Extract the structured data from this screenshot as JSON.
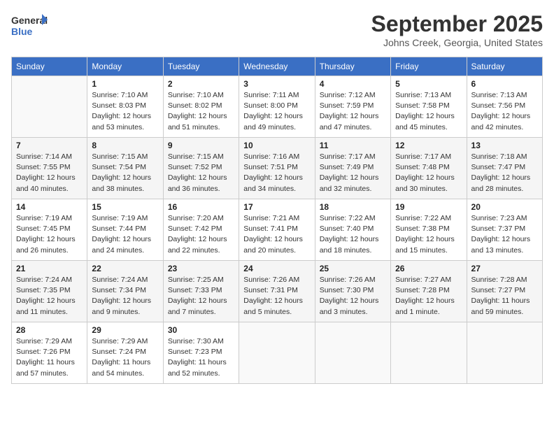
{
  "header": {
    "logo_text_general": "General",
    "logo_text_blue": "Blue",
    "month": "September 2025",
    "location": "Johns Creek, Georgia, United States"
  },
  "weekdays": [
    "Sunday",
    "Monday",
    "Tuesday",
    "Wednesday",
    "Thursday",
    "Friday",
    "Saturday"
  ],
  "weeks": [
    [
      {
        "day": "",
        "empty": true
      },
      {
        "day": "1",
        "sunrise": "7:10 AM",
        "sunset": "8:03 PM",
        "daylight": "12 hours and 53 minutes."
      },
      {
        "day": "2",
        "sunrise": "7:10 AM",
        "sunset": "8:02 PM",
        "daylight": "12 hours and 51 minutes."
      },
      {
        "day": "3",
        "sunrise": "7:11 AM",
        "sunset": "8:00 PM",
        "daylight": "12 hours and 49 minutes."
      },
      {
        "day": "4",
        "sunrise": "7:12 AM",
        "sunset": "7:59 PM",
        "daylight": "12 hours and 47 minutes."
      },
      {
        "day": "5",
        "sunrise": "7:13 AM",
        "sunset": "7:58 PM",
        "daylight": "12 hours and 45 minutes."
      },
      {
        "day": "6",
        "sunrise": "7:13 AM",
        "sunset": "7:56 PM",
        "daylight": "12 hours and 42 minutes."
      }
    ],
    [
      {
        "day": "7",
        "sunrise": "7:14 AM",
        "sunset": "7:55 PM",
        "daylight": "12 hours and 40 minutes."
      },
      {
        "day": "8",
        "sunrise": "7:15 AM",
        "sunset": "7:54 PM",
        "daylight": "12 hours and 38 minutes."
      },
      {
        "day": "9",
        "sunrise": "7:15 AM",
        "sunset": "7:52 PM",
        "daylight": "12 hours and 36 minutes."
      },
      {
        "day": "10",
        "sunrise": "7:16 AM",
        "sunset": "7:51 PM",
        "daylight": "12 hours and 34 minutes."
      },
      {
        "day": "11",
        "sunrise": "7:17 AM",
        "sunset": "7:49 PM",
        "daylight": "12 hours and 32 minutes."
      },
      {
        "day": "12",
        "sunrise": "7:17 AM",
        "sunset": "7:48 PM",
        "daylight": "12 hours and 30 minutes."
      },
      {
        "day": "13",
        "sunrise": "7:18 AM",
        "sunset": "7:47 PM",
        "daylight": "12 hours and 28 minutes."
      }
    ],
    [
      {
        "day": "14",
        "sunrise": "7:19 AM",
        "sunset": "7:45 PM",
        "daylight": "12 hours and 26 minutes."
      },
      {
        "day": "15",
        "sunrise": "7:19 AM",
        "sunset": "7:44 PM",
        "daylight": "12 hours and 24 minutes."
      },
      {
        "day": "16",
        "sunrise": "7:20 AM",
        "sunset": "7:42 PM",
        "daylight": "12 hours and 22 minutes."
      },
      {
        "day": "17",
        "sunrise": "7:21 AM",
        "sunset": "7:41 PM",
        "daylight": "12 hours and 20 minutes."
      },
      {
        "day": "18",
        "sunrise": "7:22 AM",
        "sunset": "7:40 PM",
        "daylight": "12 hours and 18 minutes."
      },
      {
        "day": "19",
        "sunrise": "7:22 AM",
        "sunset": "7:38 PM",
        "daylight": "12 hours and 15 minutes."
      },
      {
        "day": "20",
        "sunrise": "7:23 AM",
        "sunset": "7:37 PM",
        "daylight": "12 hours and 13 minutes."
      }
    ],
    [
      {
        "day": "21",
        "sunrise": "7:24 AM",
        "sunset": "7:35 PM",
        "daylight": "12 hours and 11 minutes."
      },
      {
        "day": "22",
        "sunrise": "7:24 AM",
        "sunset": "7:34 PM",
        "daylight": "12 hours and 9 minutes."
      },
      {
        "day": "23",
        "sunrise": "7:25 AM",
        "sunset": "7:33 PM",
        "daylight": "12 hours and 7 minutes."
      },
      {
        "day": "24",
        "sunrise": "7:26 AM",
        "sunset": "7:31 PM",
        "daylight": "12 hours and 5 minutes."
      },
      {
        "day": "25",
        "sunrise": "7:26 AM",
        "sunset": "7:30 PM",
        "daylight": "12 hours and 3 minutes."
      },
      {
        "day": "26",
        "sunrise": "7:27 AM",
        "sunset": "7:28 PM",
        "daylight": "12 hours and 1 minute."
      },
      {
        "day": "27",
        "sunrise": "7:28 AM",
        "sunset": "7:27 PM",
        "daylight": "11 hours and 59 minutes."
      }
    ],
    [
      {
        "day": "28",
        "sunrise": "7:29 AM",
        "sunset": "7:26 PM",
        "daylight": "11 hours and 57 minutes."
      },
      {
        "day": "29",
        "sunrise": "7:29 AM",
        "sunset": "7:24 PM",
        "daylight": "11 hours and 54 minutes."
      },
      {
        "day": "30",
        "sunrise": "7:30 AM",
        "sunset": "7:23 PM",
        "daylight": "11 hours and 52 minutes."
      },
      {
        "day": "",
        "empty": true
      },
      {
        "day": "",
        "empty": true
      },
      {
        "day": "",
        "empty": true
      },
      {
        "day": "",
        "empty": true
      }
    ]
  ]
}
